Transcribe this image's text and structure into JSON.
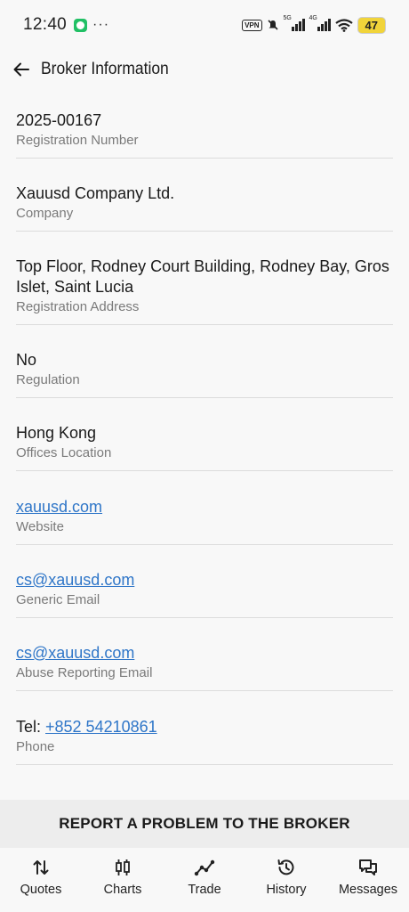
{
  "status_bar": {
    "time": "12:40",
    "dots": "···",
    "vpn": "VPN",
    "sim1": "5G",
    "sim2": "4G",
    "battery": "47"
  },
  "header": {
    "title": "Broker Information"
  },
  "items": [
    {
      "value": "2025-00167",
      "label": "Registration Number"
    },
    {
      "value": "Xauusd Company Ltd.",
      "label": "Company"
    },
    {
      "value": "Top Floor, Rodney Court Building, Rodney Bay, Gros Islet, Saint Lucia",
      "label": "Registration Address"
    },
    {
      "value": "No",
      "label": "Regulation"
    },
    {
      "value": "Hong Kong",
      "label": "Offices Location"
    },
    {
      "value": "xauusd.com",
      "label": "Website"
    },
    {
      "value": "cs@xauusd.com",
      "label": "Generic Email"
    },
    {
      "value": "cs@xauusd.com",
      "label": "Abuse Reporting Email"
    },
    {
      "prefix": "Tel: ",
      "value": "+852 54210861",
      "label": "Phone"
    }
  ],
  "report_button": "REPORT A PROBLEM TO THE BROKER",
  "tabs": [
    {
      "label": "Quotes",
      "icon": "arrows-up-down-icon",
      "active": true
    },
    {
      "label": "Charts",
      "icon": "candlestick-icon"
    },
    {
      "label": "Trade",
      "icon": "trade-line-icon"
    },
    {
      "label": "History",
      "icon": "history-clock-icon"
    },
    {
      "label": "Messages",
      "icon": "messages-icon"
    }
  ],
  "colors": {
    "link": "#2f76c8",
    "label": "#7a7a7a",
    "background": "#f8f8f8"
  }
}
